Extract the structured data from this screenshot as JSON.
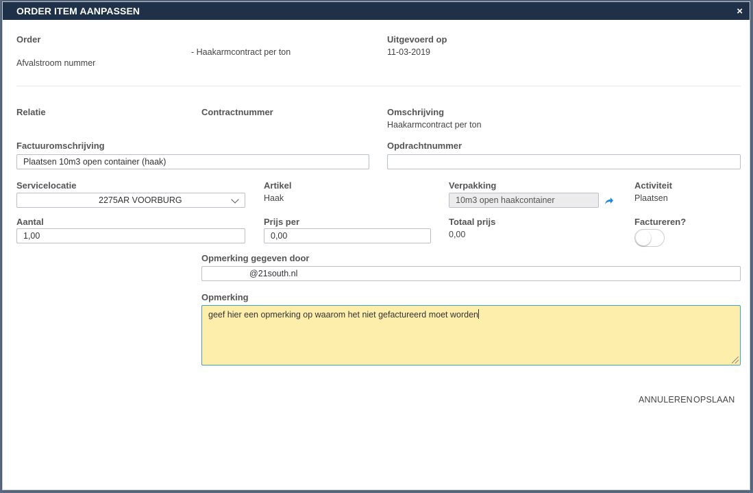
{
  "dialog": {
    "title": "ORDER ITEM AANPASSEN",
    "close": "×"
  },
  "order": {
    "label": "Order",
    "value": "- Haakarmcontract per ton",
    "afvalstroom_label": "Afvalstroom nummer"
  },
  "uitgevoerd": {
    "label": "Uitgevoerd op",
    "value": "11-03-2019"
  },
  "relatie": {
    "label": "Relatie",
    "value": ""
  },
  "contractnummer": {
    "label": "Contractnummer",
    "value": ""
  },
  "omschrijving": {
    "label": "Omschrijving",
    "value": "Haakarmcontract per ton"
  },
  "factuuromschrijving": {
    "label": "Factuuromschrijving",
    "value": "Plaatsen 10m3 open container (haak)"
  },
  "opdrachtnummer": {
    "label": "Opdrachtnummer",
    "value": ""
  },
  "servicelocatie": {
    "label": "Servicelocatie",
    "value": "2275AR VOORBURG"
  },
  "artikel": {
    "label": "Artikel",
    "value": "Haak"
  },
  "verpakking": {
    "label": "Verpakking",
    "value": "10m3 open haakcontainer",
    "icon": "share-arrow-icon"
  },
  "activiteit": {
    "label": "Activiteit",
    "value": "Plaatsen"
  },
  "aantal": {
    "label": "Aantal",
    "value": "1,00"
  },
  "prijs_per": {
    "label": "Prijs per",
    "value": "0,00"
  },
  "totaal_prijs": {
    "label": "Totaal prijs",
    "value": "0,00"
  },
  "factureren": {
    "label": "Factureren?",
    "state": "off"
  },
  "opmerking_door": {
    "label": "Opmerking gegeven door",
    "value": "@21south.nl"
  },
  "opmerking": {
    "label": "Opmerking",
    "value": "geef hier een opmerking op waarom het niet gefactureerd moet worden"
  },
  "actions": {
    "cancel": "ANNULEREN",
    "save": "OPSLAAN"
  },
  "colors": {
    "titlebar": "#1f3049",
    "textarea_bg": "#fdeeac",
    "accent": "#1e88e5"
  }
}
